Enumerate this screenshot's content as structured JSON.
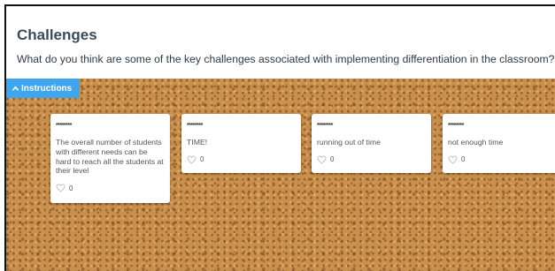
{
  "header": {
    "title": "Challenges",
    "question": "What do you think are some of the key challenges associated with implementing differentiation in the classroom?"
  },
  "board": {
    "instructions_label": "Instructions",
    "cards": [
      {
        "author": "********",
        "text": "The overall number of students with different needs can be hard to reach all the students at their level",
        "likes": "0"
      },
      {
        "author": "********",
        "text": "TIME!",
        "likes": "0"
      },
      {
        "author": "********",
        "text": "running out of time",
        "likes": "0"
      },
      {
        "author": "********",
        "text": "not enough time",
        "likes": "0"
      }
    ]
  },
  "colors": {
    "accent": "#3ea6ee",
    "board": "#c98f4c",
    "title": "#3b4a5a"
  },
  "icons": {
    "instructions_toggle": "chevron-up-icon",
    "like": "heart-outline-icon"
  }
}
